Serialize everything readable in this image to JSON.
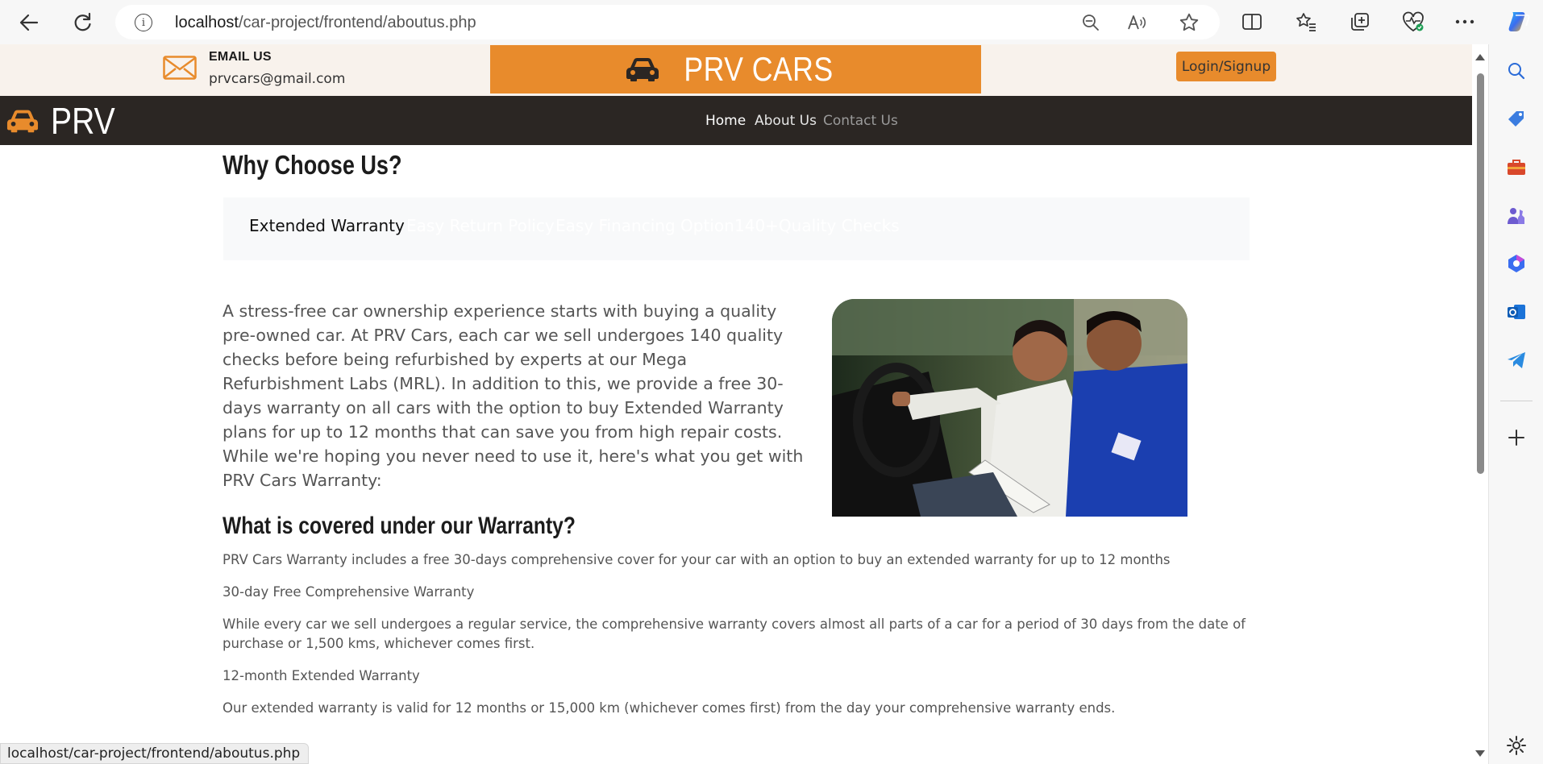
{
  "browser": {
    "url_host": "localhost",
    "url_path": "/car-project/frontend/aboutus.php",
    "status_url": "localhost/car-project/frontend/aboutus.php",
    "icons": [
      "back-arrow-icon",
      "refresh-icon",
      "info-icon",
      "zoom-out-icon",
      "read-aloud-icon",
      "favorite-star-icon",
      "split-screen-icon",
      "favorites-icon",
      "collections-icon",
      "browser-essentials-icon",
      "more-menu-icon",
      "copilot-icon"
    ],
    "sidebar_icons": [
      "search-icon",
      "shopping-tag-icon",
      "tools-icon",
      "games-icon",
      "microsoft-365-icon",
      "outlook-icon",
      "telegram-icon",
      "add-icon",
      "settings-icon"
    ]
  },
  "header": {
    "email_title": "EMAIL US",
    "email_value": "prvcars@gmail.com",
    "brand_banner": "PRV CARS",
    "login_label": "Login/Signup",
    "accent_color": "#e88b2c"
  },
  "navbar": {
    "logo_text": "PRV",
    "links": [
      {
        "label": "Home",
        "color": "#ffffff"
      },
      {
        "label": "About Us",
        "color": "#e6e6e6"
      },
      {
        "label": "Contact Us",
        "color": "#9a9a9a"
      }
    ]
  },
  "why": {
    "heading": "Why Choose Us?",
    "tabs": [
      {
        "label": "Extended Warranty",
        "active": true
      },
      {
        "label": "Easy Return Policy",
        "active": false
      },
      {
        "label": "Easy Financing Option",
        "active": false
      },
      {
        "label": "140+Quality Checks",
        "active": false
      }
    ],
    "paragraph_1": "A stress-free car ownership experience starts with buying a quality pre-owned car. At PRV Cars, each car we sell undergoes 140 quality checks before being refurbished by experts at our Mega Refurbishment Labs (MRL). In addition to this, we provide a free 30-days warranty on all cars with the option to buy Extended Warranty plans for up to 12 months that can save you from high repair costs.",
    "paragraph_2": "While we're hoping you never need to use it, here's what you get with PRV Cars Warranty:"
  },
  "warranty": {
    "heading": "What is covered under our Warranty?",
    "intro": "PRV Cars Warranty includes a free 30-days comprehensive cover for your car with an option to buy an extended warranty for up to 12 months",
    "free_title": "30-day Free Comprehensive Warranty",
    "free_desc": "While every car we sell undergoes a regular service, the comprehensive warranty covers almost all parts of a car for a period of 30 days from the date of purchase or 1,500 kms, whichever comes first.",
    "ext_title": "12-month Extended Warranty",
    "ext_desc": "Our extended warranty is valid for 12 months or 15,000 km (whichever comes first) from the day your comprehensive warranty ends."
  }
}
